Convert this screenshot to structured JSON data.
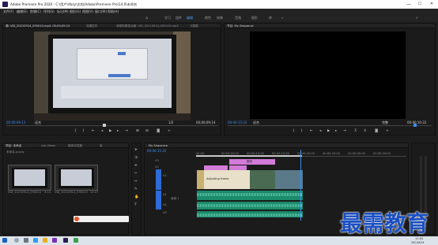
{
  "window": {
    "title": "Adobe Premiere Pro 2020 - C:\\用户\\Xbzy\\文档\\Adobe\\Premiere Pro\\14.0\\未命名",
    "minimize": "—",
    "maximize": "☐",
    "close": "✕"
  },
  "menu": [
    "文件(F)",
    "编辑(E)",
    "剪辑(C)",
    "序列(S)",
    "标记(M)",
    "图形(G)",
    "视图(V)",
    "窗口(W)",
    "帮助(H)"
  ],
  "workspaces": {
    "items": [
      "学习",
      "组件",
      "编辑",
      "颜色",
      "效果",
      "音频",
      "图形",
      "库"
    ],
    "active": "编辑"
  },
  "source_panel": {
    "tabs": [
      "源: VID_20210914_095010.mp4: 00;00;09;14",
      "效果控件",
      "音频剪辑混合器: VID_20210914_095010.mp4",
      "元数据"
    ],
    "timecode_in": "00:00:09:13",
    "fit_label": "适合",
    "ratio": "1/2",
    "timecode_out": "00;00;09;14"
  },
  "program_panel": {
    "tabs": [
      "节目: My Sequence"
    ],
    "timecode_in": "00:00:15:22",
    "fit_label": "适合",
    "quality": "完整",
    "timecode_out": "00:00:10:22"
  },
  "project_panel": {
    "tabs": [
      "项目: 未命名",
      "Lab Views",
      "媒体浏览器",
      "库"
    ],
    "project_name": "未命名.prproj",
    "clips": [
      {
        "name": "VID_20210914_095010.mp4",
        "duration": "9:14"
      },
      {
        "name": "VID_20210914_095015.mp4",
        "duration": "13:27"
      }
    ]
  },
  "timeline": {
    "tab": "My Sequence",
    "timecode": "00:00:15:22",
    "ruler": [
      "00:00",
      "00:00:05:00",
      "00:00:10:00",
      "00:00:15:00",
      "00:00:20:00",
      "00:00:25:00",
      "00:00:30:00",
      "00:00:35:00"
    ],
    "video_tracks": [
      "V3",
      "V2",
      "V1"
    ],
    "audio_tracks": [
      "A1",
      "A2",
      "A3"
    ],
    "audio_label": "音频 1",
    "title_clip": "图形",
    "video_clip_caption": "Adjusting frame"
  },
  "taskbar": {
    "search_placeholder": "",
    "time": "11:02",
    "date": "2021/9/24"
  },
  "watermark": "最需教育",
  "colors": {
    "accent_blue": "#2d6bd6",
    "timecode_blue": "#3b8df0",
    "clip_pink": "#d27bd8",
    "audio_green": "#1a8a6a",
    "watermark": "#1a4fc4"
  }
}
